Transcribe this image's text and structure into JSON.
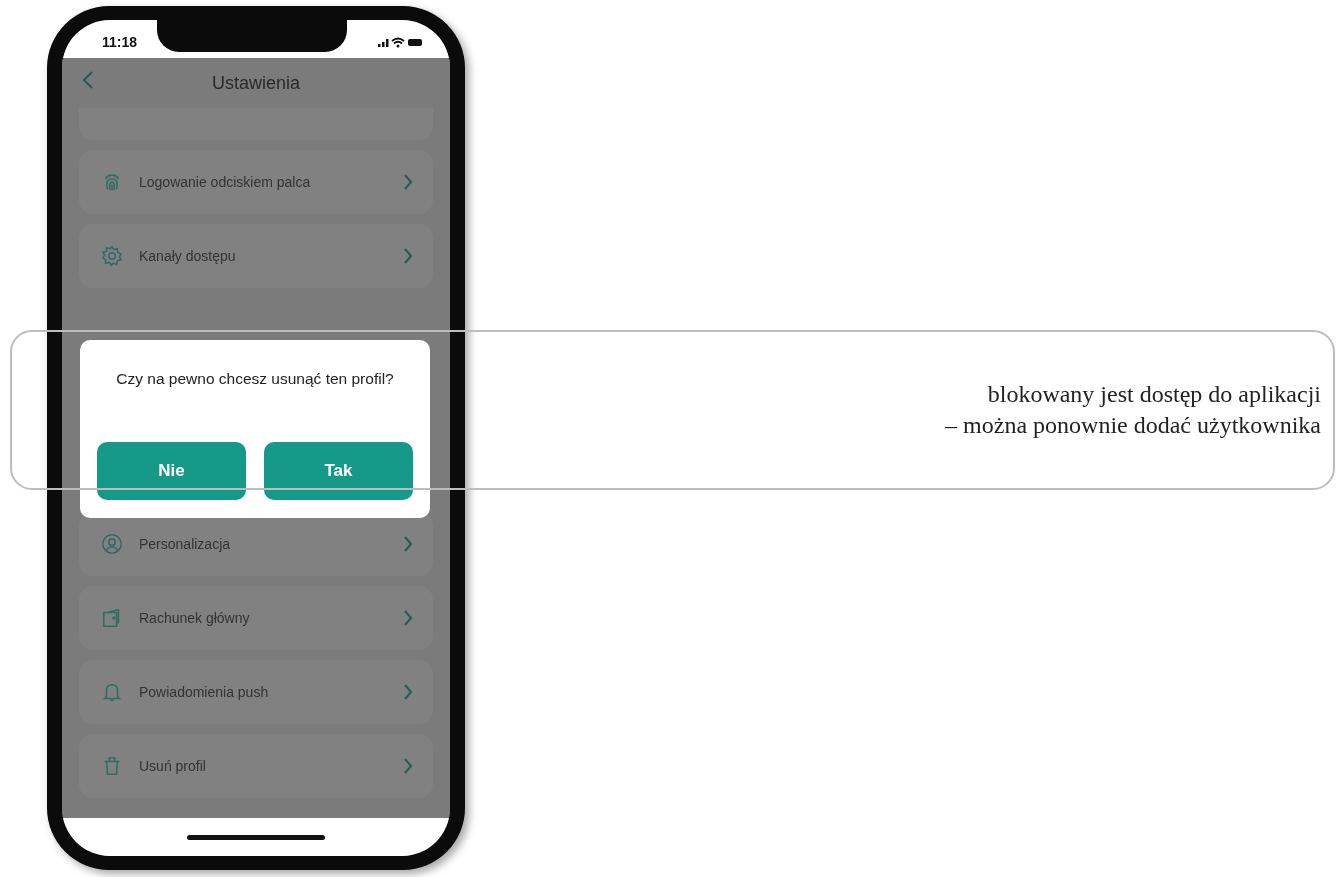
{
  "status_bar": {
    "time": "11:18"
  },
  "header": {
    "title": "Ustawienia"
  },
  "menu_items": [
    {
      "kind": "partial"
    },
    {
      "kind": "fingerprint",
      "label": "Logowanie odciskiem palca"
    },
    {
      "kind": "gear",
      "label": "Kanały dostępu"
    },
    {
      "kind": "gap"
    },
    {
      "kind": "user",
      "label": "Personalizacja"
    },
    {
      "kind": "wallet",
      "label": "Rachunek główny"
    },
    {
      "kind": "bell",
      "label": "Powiadomienia push"
    },
    {
      "kind": "trash",
      "label": "Usuń profil"
    }
  ],
  "dialog": {
    "message": "Czy na pewno chcesz usunąć ten profil?",
    "buttons": [
      "Nie",
      "Tak"
    ]
  },
  "caption": {
    "lines": [
      "blokowany jest dostęp do aplikacji",
      "– można ponownie dodać użytkownika"
    ]
  }
}
